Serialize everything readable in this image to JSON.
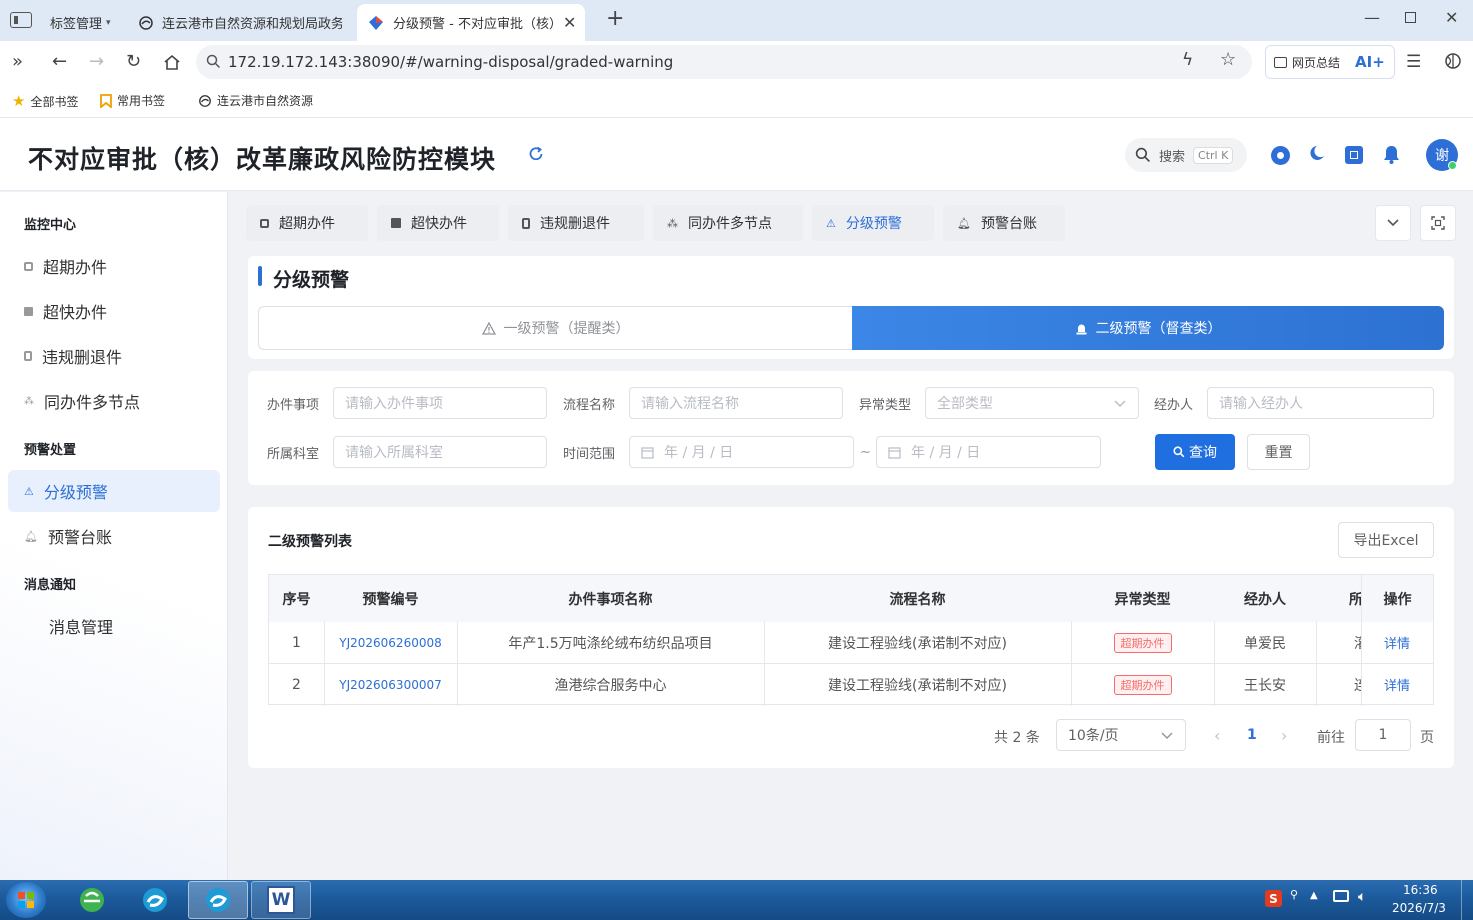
{
  "browser": {
    "tabs": [
      {
        "label": "标签管理"
      },
      {
        "label": "连云港市自然资源和规划局政务"
      },
      {
        "label": "分级预警 - 不对应审批（核）i"
      }
    ],
    "url": "172.19.172.143:38090/#/warning-disposal/graded-warning",
    "summary_label": "网页总结",
    "ai_label": "AI+",
    "bookmarks": [
      "全部书签",
      "常用书签",
      "连云港市自然资源"
    ]
  },
  "header": {
    "title": "不对应审批（核）改革廉政风险防控模块",
    "search_label": "搜索",
    "search_shortcut": "Ctrl K",
    "avatar_text": "谢"
  },
  "sidebar": {
    "groups": [
      {
        "title": "监控中心",
        "items": [
          "超期办件",
          "超快办件",
          "违规删退件",
          "同办件多节点"
        ]
      },
      {
        "title": "预警处置",
        "items": [
          "分级预警",
          "预警台账"
        ]
      },
      {
        "title": "消息通知",
        "items": [
          "消息管理"
        ]
      }
    ]
  },
  "page_tabs": [
    "超期办件",
    "超快办件",
    "违规删退件",
    "同办件多节点",
    "分级预警",
    "预警台账"
  ],
  "main": {
    "title": "分级预警",
    "level1_label": "一级预警（提醒类）",
    "level2_label": "二级预警（督查类）"
  },
  "filters": {
    "item_label": "办件事项",
    "item_placeholder": "请输入办件事项",
    "flow_label": "流程名称",
    "flow_placeholder": "请输入流程名称",
    "type_label": "异常类型",
    "type_value": "全部类型",
    "handler_label": "经办人",
    "handler_placeholder": "请输入经办人",
    "dept_label": "所属科室",
    "dept_placeholder": "请输入所属科室",
    "time_label": "时间范围",
    "date_placeholder": "年 / 月 / 日",
    "date_sep": "~",
    "query_label": "查询",
    "reset_label": "重置"
  },
  "list": {
    "title": "二级预警列表",
    "export_label": "导出Excel",
    "columns": [
      "序号",
      "预警编号",
      "办件事项名称",
      "流程名称",
      "异常类型",
      "经办人",
      "所",
      "操作"
    ],
    "rows": [
      {
        "no": "1",
        "code": "YJ202606260008",
        "item": "年产1.5万吨涤纶绒布纺织品项目",
        "flow": "建设工程验线(承诺制不对应)",
        "type": "超期办件",
        "handler": "单爱民",
        "dept": "灌",
        "action": "详情"
      },
      {
        "no": "2",
        "code": "YJ202606300007",
        "item": "渔港综合服务中心",
        "flow": "建设工程验线(承诺制不对应)",
        "type": "超期办件",
        "handler": "王长安",
        "dept": "连",
        "action": "详情"
      }
    ]
  },
  "pagination": {
    "total": "共 2 条",
    "page_size": "10条/页",
    "current_page": "1",
    "goto_label": "前往",
    "goto_value": "1",
    "page_suffix": "页"
  },
  "taskbar": {
    "time": "16:36",
    "date": "2026/7/3"
  },
  "colors": {
    "accent": "#2d6fd6",
    "danger": "#f56c6c",
    "banner": "#3b86e6"
  }
}
